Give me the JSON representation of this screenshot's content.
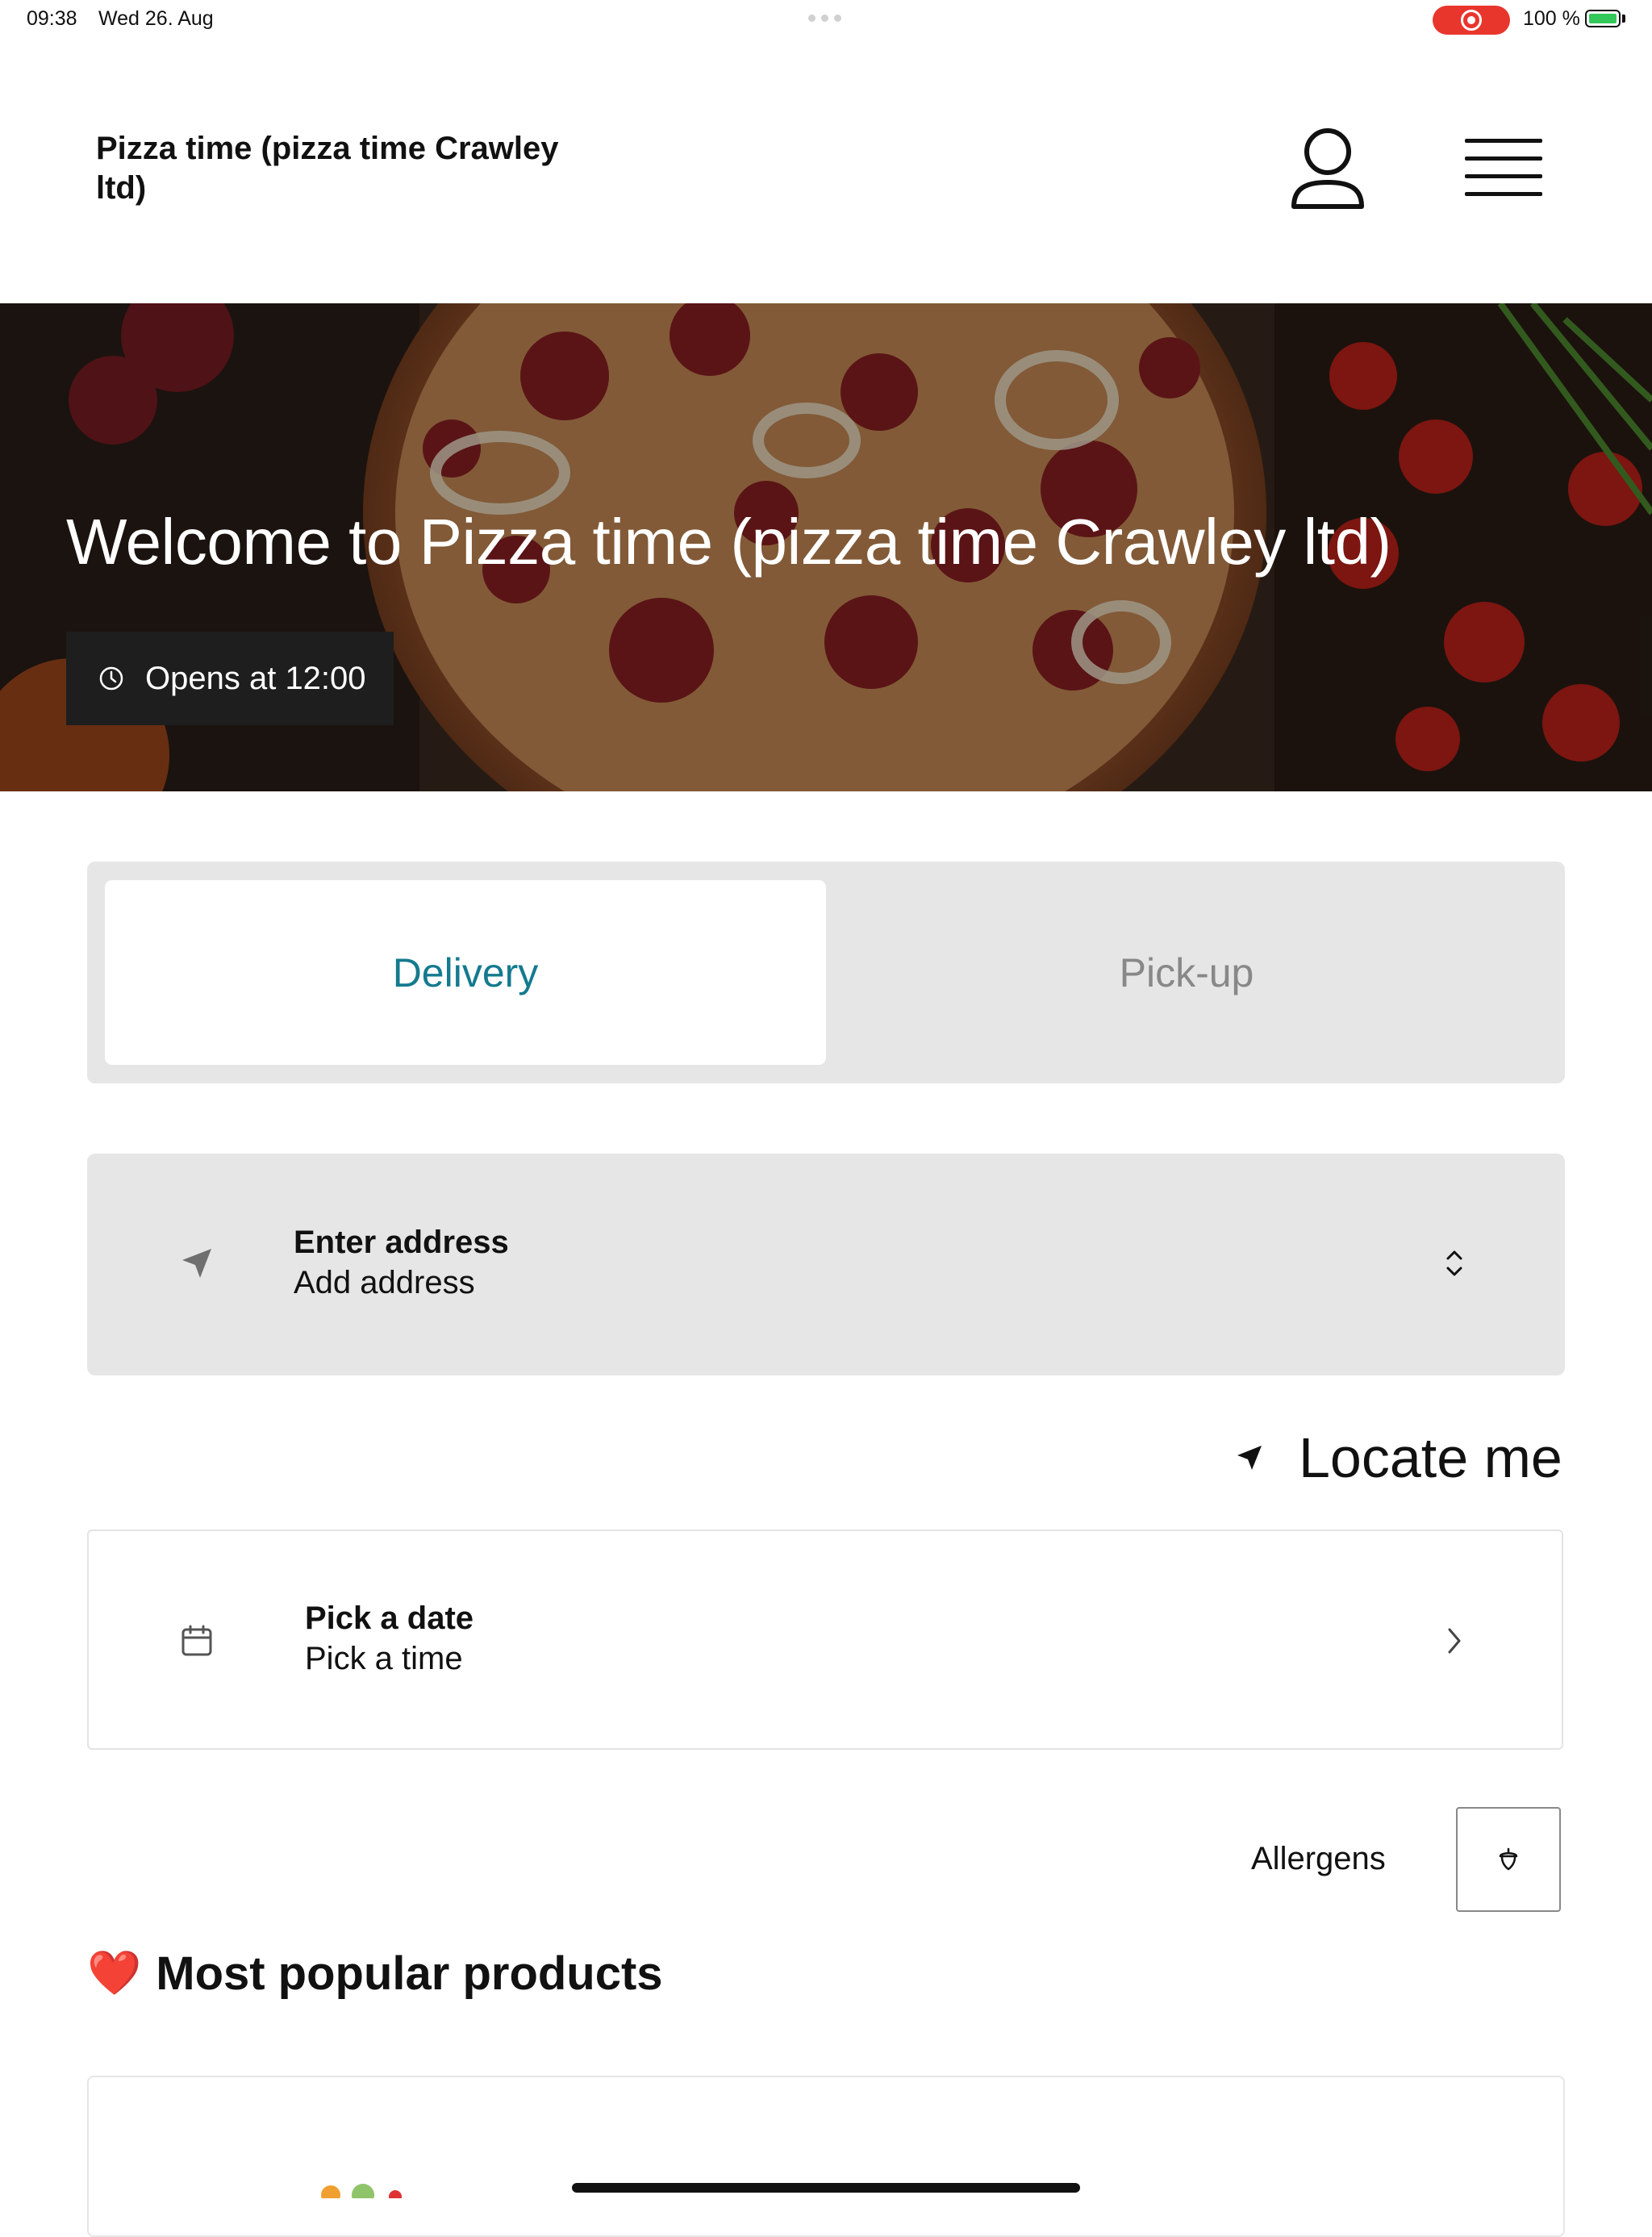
{
  "status_bar": {
    "time": "09:38",
    "date": "Wed 26. Aug",
    "battery": "100 %"
  },
  "header": {
    "store_name": "Pizza time (pizza time Crawley ltd)",
    "profile_icon": "person-icon",
    "menu_icon": "hamburger-menu-icon"
  },
  "hero": {
    "title": "Welcome to Pizza time (pizza time Crawley ltd)",
    "opening_status": "Opens at 12:00",
    "clock_icon": "clock-icon"
  },
  "order_mode": {
    "tabs": [
      {
        "label": "Delivery",
        "selected": true
      },
      {
        "label": "Pick-up",
        "selected": false
      }
    ]
  },
  "address": {
    "title": "Enter address",
    "subtitle": "Add address",
    "icon": "navigation-arrow-icon"
  },
  "locate": {
    "label": "Locate me"
  },
  "schedule": {
    "title": "Pick a date",
    "subtitle": "Pick a time",
    "icon": "calendar-icon"
  },
  "allergens": {
    "label": "Allergens",
    "icon": "acorn-icon"
  },
  "popular": {
    "heading": "Most popular products",
    "emoji": "❤️"
  },
  "colors": {
    "accent": "#147a8f",
    "panel": "#e6e6e6",
    "badge": "#1e1e1e",
    "record": "#e8362d",
    "battery": "#34c759"
  }
}
